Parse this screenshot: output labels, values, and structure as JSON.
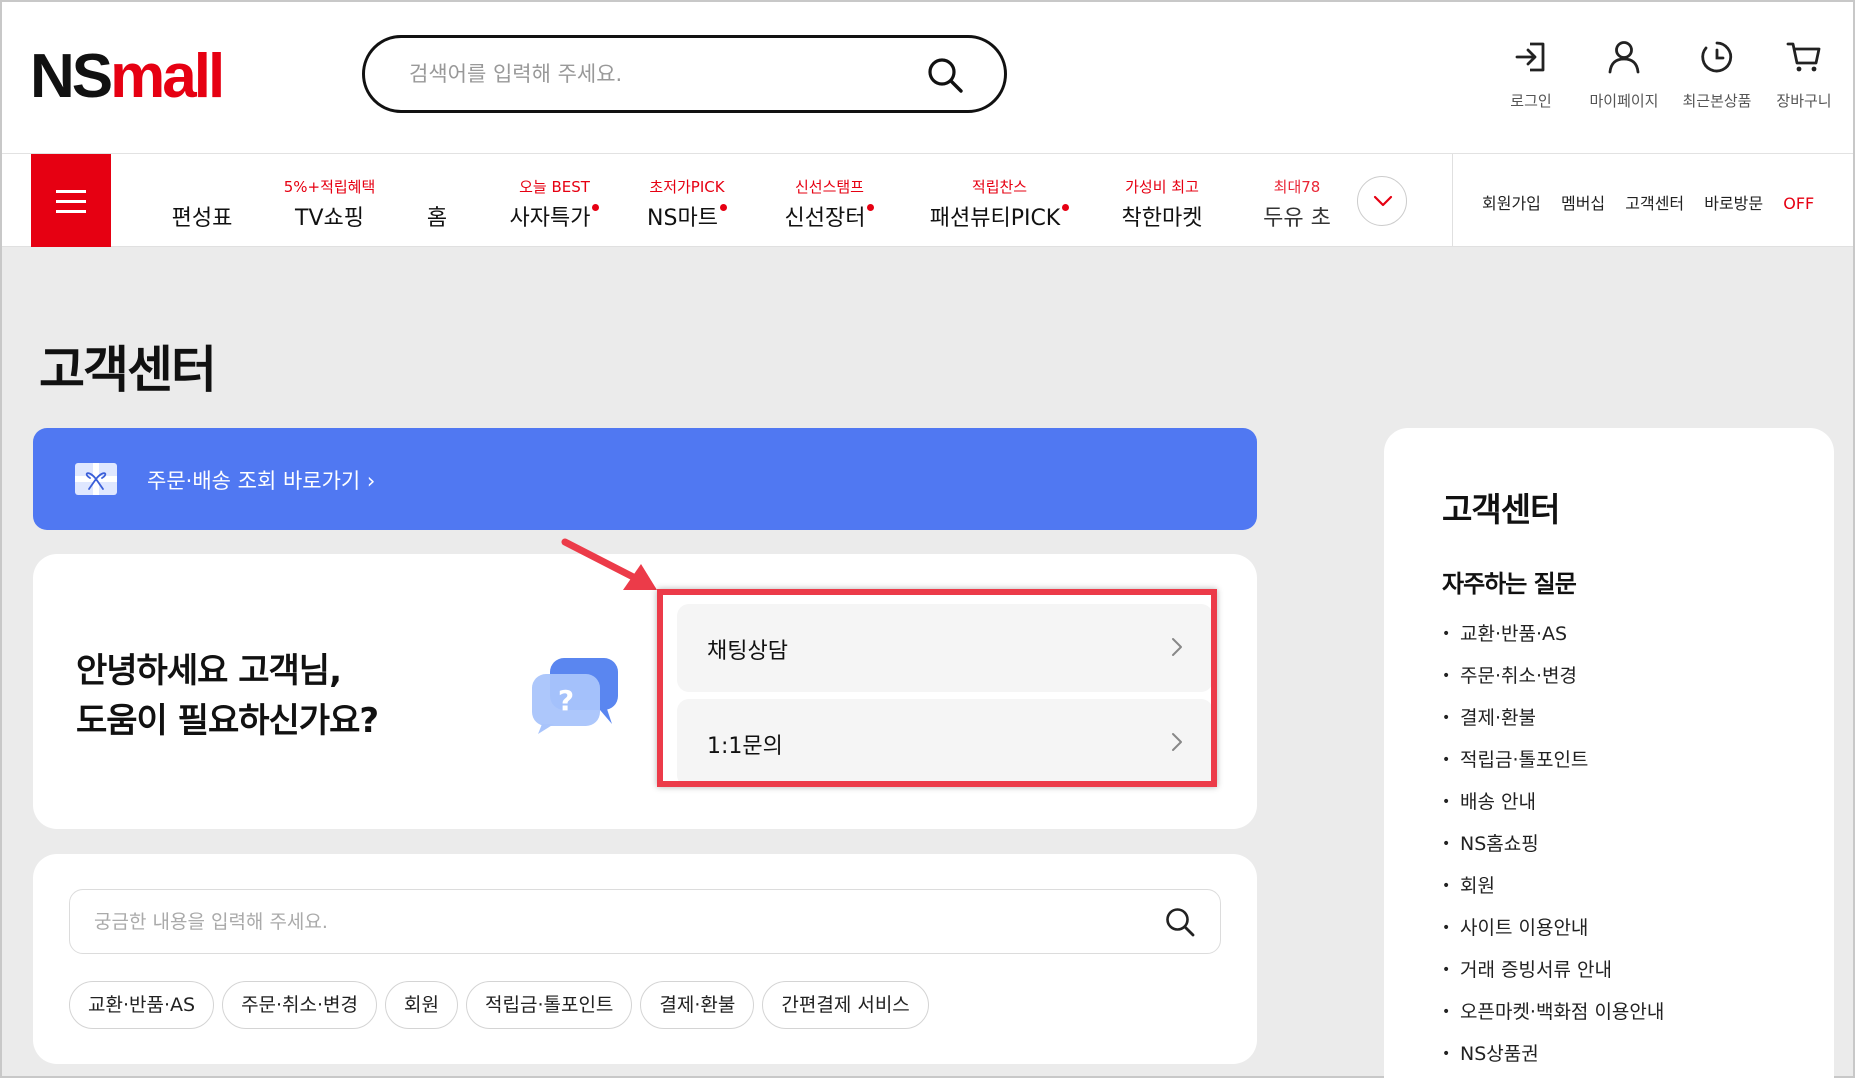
{
  "header": {
    "logo_ns": "NS",
    "logo_mall": "mall",
    "search_placeholder": "검색어를 입력해 주세요.",
    "utils": [
      {
        "label": "로그인",
        "icon": "login-icon"
      },
      {
        "label": "마이페이지",
        "icon": "user-icon"
      },
      {
        "label": "최근본상품",
        "icon": "clock-icon"
      },
      {
        "label": "장바구니",
        "icon": "cart-icon"
      }
    ]
  },
  "nav": {
    "items": [
      {
        "sub": "",
        "main": "편성표"
      },
      {
        "sub": "5%+적립혜택",
        "main": "TV쇼핑"
      },
      {
        "sub": "",
        "main": "홈"
      },
      {
        "sub": "오늘 BEST",
        "main": "사자특가"
      },
      {
        "sub": "초저가PICK",
        "main": "NS마트"
      },
      {
        "sub": "신선스탬프",
        "main": "신선장터"
      },
      {
        "sub": "적립찬스",
        "main": "패션뷰티PICK"
      },
      {
        "sub": "가성비 최고",
        "main": "착한마켓"
      },
      {
        "sub": "최대78",
        "main": "두유 초"
      }
    ],
    "links": [
      "회원가입",
      "멤버십",
      "고객센터"
    ],
    "quick_visit_label": "바로방문",
    "quick_visit_state": "OFF",
    "accent": "#e60012"
  },
  "page": {
    "title": "고객센터",
    "banner_text": "주문·배송 조회 바로가기",
    "banner_color": "#5078f2"
  },
  "help": {
    "greeting_line1": "안녕하세요 고객님,",
    "greeting_line2": "도움이 필요하신가요?",
    "bubble_mark": "?",
    "options": [
      "채팅상담",
      "1:1문의"
    ]
  },
  "faq": {
    "search_placeholder": "궁금한 내용을 입력해 주세요.",
    "chips": [
      "교환·반품·AS",
      "주문·취소·변경",
      "회원",
      "적립금·톨포인트",
      "결제·환불",
      "간편결제 서비스"
    ]
  },
  "sidebar": {
    "title": "고객센터",
    "subtitle": "자주하는 질문",
    "items": [
      "교환·반품·AS",
      "주문·취소·변경",
      "결제·환불",
      "적립금·톨포인트",
      "배송 안내",
      "NS홈쇼핑",
      "회원",
      "사이트 이용안내",
      "거래 증빙서류 안내",
      "오픈마켓·백화점 이용안내",
      "NS상품권"
    ]
  }
}
